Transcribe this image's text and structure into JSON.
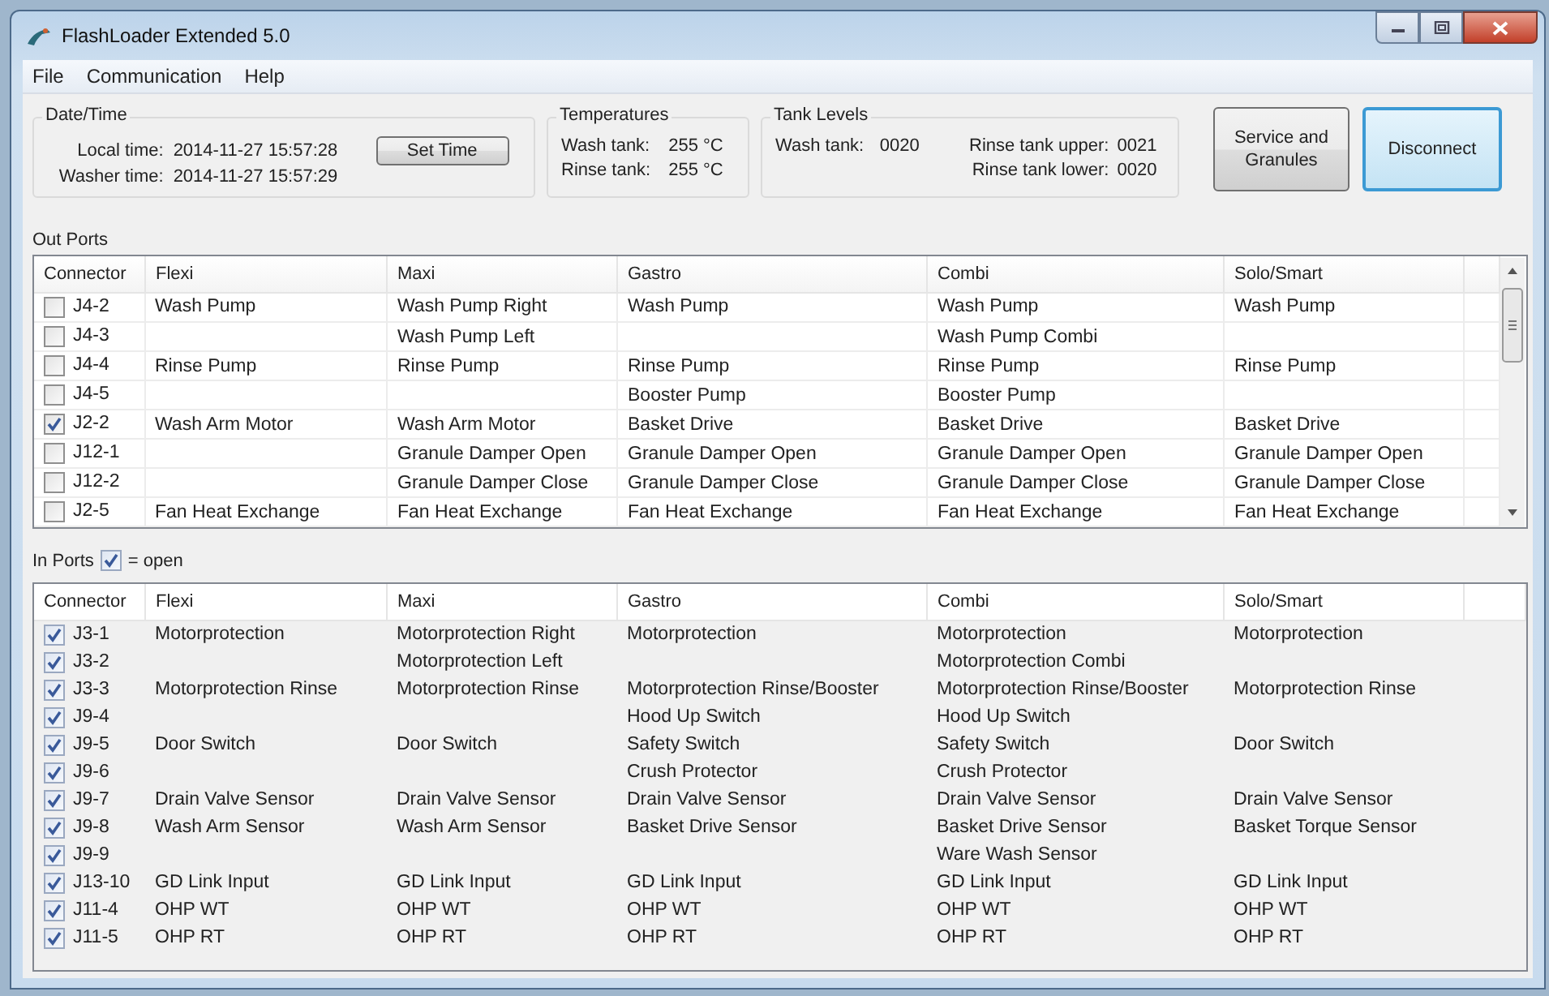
{
  "window": {
    "title": "FlashLoader Extended 5.0"
  },
  "menu": [
    "File",
    "Communication",
    "Help"
  ],
  "date_time": {
    "title": "Date/Time",
    "rows": [
      {
        "label": "Local time:",
        "value": "2014-11-27  15:57:28"
      },
      {
        "label": "Washer time:",
        "value": "2014-11-27  15:57:29"
      }
    ],
    "button": "Set Time"
  },
  "temperatures": {
    "title": "Temperatures",
    "rows": [
      {
        "label": "Wash tank:",
        "value": "255 °C"
      },
      {
        "label": "Rinse tank:",
        "value": "255 °C"
      }
    ]
  },
  "tank_levels": {
    "title": "Tank Levels",
    "wash": {
      "label": "Wash tank:",
      "value": "0020"
    },
    "rinse": [
      {
        "label": "Rinse tank upper:",
        "value": "0021"
      },
      {
        "label": "Rinse tank lower:",
        "value": "0020"
      }
    ]
  },
  "buttons": [
    {
      "label": "Service and Granules",
      "focused": false
    },
    {
      "label": "Disconnect",
      "focused": true
    }
  ],
  "out_ports": {
    "title": "Out Ports",
    "columns": [
      "Connector",
      "Flexi",
      "Maxi",
      "Gastro",
      "Combi",
      "Solo/Smart"
    ],
    "rows": [
      {
        "checked": false,
        "cells": [
          "J4-2",
          "Wash Pump",
          "Wash Pump Right",
          "Wash Pump",
          "Wash Pump",
          "Wash Pump"
        ]
      },
      {
        "checked": false,
        "cells": [
          "J4-3",
          null,
          "Wash Pump Left",
          null,
          "Wash Pump Combi",
          null
        ]
      },
      {
        "checked": false,
        "cells": [
          "J4-4",
          "Rinse Pump",
          "Rinse Pump",
          "Rinse Pump",
          "Rinse Pump",
          "Rinse Pump"
        ]
      },
      {
        "checked": false,
        "cells": [
          "J4-5",
          null,
          null,
          "Booster Pump",
          "Booster Pump",
          null
        ]
      },
      {
        "checked": true,
        "cells": [
          "J2-2",
          "Wash Arm Motor",
          "Wash Arm Motor",
          "Basket Drive",
          "Basket Drive",
          "Basket Drive"
        ]
      },
      {
        "checked": false,
        "cells": [
          "J12-1",
          null,
          "Granule Damper Open",
          "Granule Damper Open",
          "Granule Damper Open",
          "Granule Damper Open"
        ]
      },
      {
        "checked": false,
        "cells": [
          "J12-2",
          null,
          "Granule Damper Close",
          "Granule Damper Close",
          "Granule Damper Close",
          "Granule Damper Close"
        ]
      },
      {
        "checked": false,
        "cells": [
          "J2-5",
          "Fan Heat Exchange",
          "Fan Heat Exchange",
          "Fan Heat Exchange",
          "Fan Heat Exchange",
          "Fan Heat Exchange"
        ]
      }
    ]
  },
  "in_ports": {
    "title": "In Ports",
    "legend": {
      "checked": true,
      "text": "= open"
    },
    "columns": [
      "Connector",
      "Flexi",
      "Maxi",
      "Gastro",
      "Combi",
      "Solo/Smart"
    ],
    "rows": [
      {
        "checked": true,
        "cells": [
          "J3-1",
          "Motorprotection",
          "Motorprotection Right",
          "Motorprotection",
          "Motorprotection",
          "Motorprotection"
        ]
      },
      {
        "checked": true,
        "cells": [
          "J3-2",
          null,
          "Motorprotection Left",
          null,
          "Motorprotection Combi",
          null
        ]
      },
      {
        "checked": true,
        "cells": [
          "J3-3",
          "Motorprotection Rinse",
          "Motorprotection Rinse",
          "Motorprotection Rinse/Booster",
          "Motorprotection Rinse/Booster",
          "Motorprotection Rinse"
        ]
      },
      {
        "checked": true,
        "cells": [
          "J9-4",
          null,
          null,
          "Hood Up Switch",
          "Hood Up Switch",
          null
        ]
      },
      {
        "checked": true,
        "cells": [
          "J9-5",
          "Door Switch",
          "Door Switch",
          "Safety Switch",
          "Safety Switch",
          "Door Switch"
        ]
      },
      {
        "checked": true,
        "cells": [
          "J9-6",
          null,
          null,
          "Crush Protector",
          "Crush Protector",
          null
        ]
      },
      {
        "checked": true,
        "cells": [
          "J9-7",
          "Drain Valve Sensor",
          "Drain Valve Sensor",
          "Drain Valve Sensor",
          "Drain Valve Sensor",
          "Drain Valve Sensor"
        ]
      },
      {
        "checked": true,
        "cells": [
          "J9-8",
          "Wash Arm Sensor",
          "Wash Arm Sensor",
          "Basket Drive Sensor",
          "Basket Drive Sensor",
          "Basket Torque Sensor"
        ]
      },
      {
        "checked": true,
        "cells": [
          "J9-9",
          null,
          null,
          null,
          "Ware Wash Sensor",
          null
        ]
      },
      {
        "checked": true,
        "cells": [
          "J13-10",
          "GD Link Input",
          "GD Link Input",
          "GD Link Input",
          "GD Link Input",
          "GD Link Input"
        ]
      },
      {
        "checked": true,
        "cells": [
          "J11-4",
          "OHP WT",
          "OHP WT",
          "OHP WT",
          "OHP WT",
          "OHP WT"
        ]
      },
      {
        "checked": true,
        "cells": [
          "J11-5",
          "OHP RT",
          "OHP RT",
          "OHP RT",
          "OHP RT",
          "OHP RT"
        ]
      }
    ]
  }
}
